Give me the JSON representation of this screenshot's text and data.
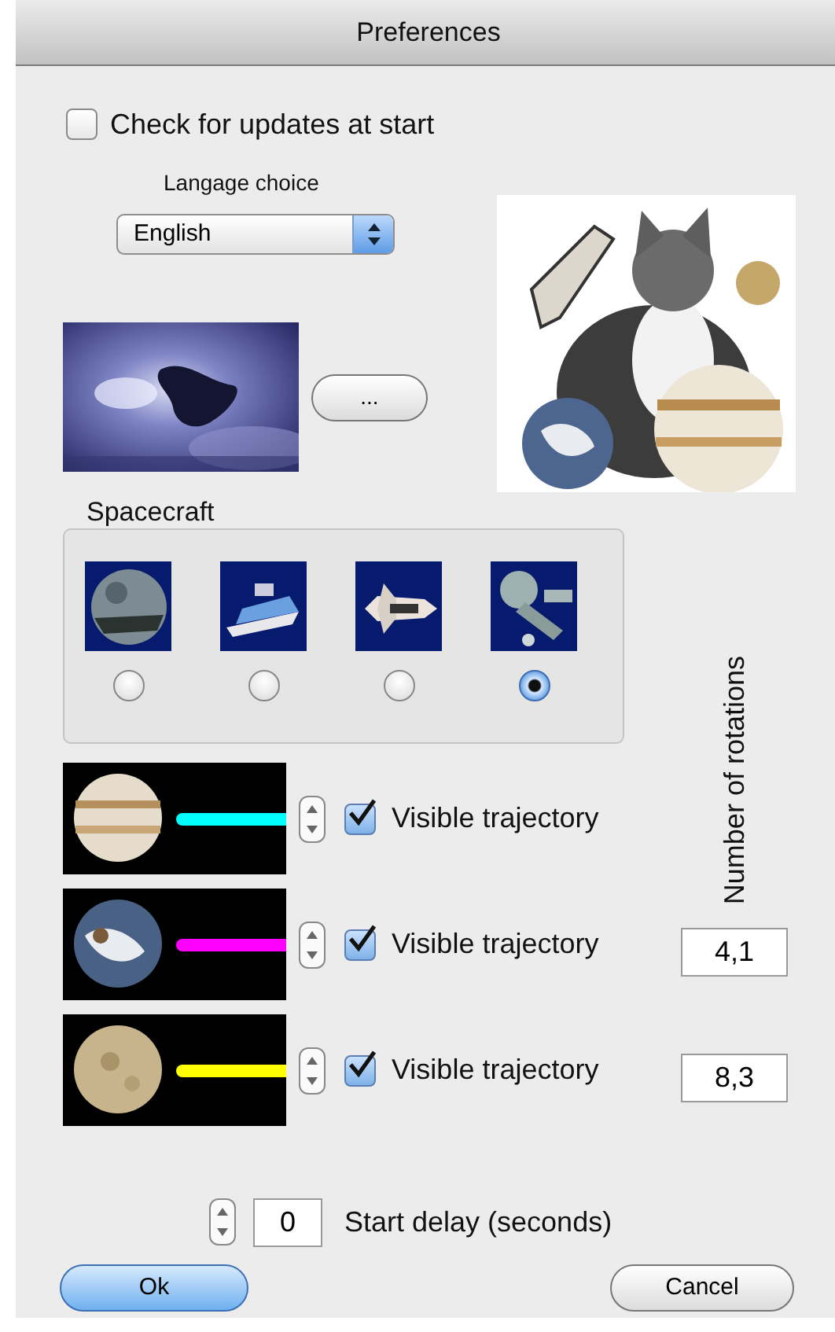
{
  "window": {
    "title": "Preferences"
  },
  "check_updates": {
    "label": "Check for updates at start",
    "checked": false
  },
  "language": {
    "label": "Langage choice",
    "value": "English"
  },
  "background": {
    "button_label": "..."
  },
  "spacecraft": {
    "title": "Spacecraft",
    "options": [
      {
        "kind": "sphere",
        "selected": false
      },
      {
        "kind": "wedge",
        "selected": false
      },
      {
        "kind": "shuttle",
        "selected": false
      },
      {
        "kind": "station",
        "selected": true
      }
    ]
  },
  "rotations_label": "Number of rotations",
  "planets": [
    {
      "kind": "banded",
      "color": "#00ffff",
      "visible_trajectory": true,
      "label": "Visible trajectory"
    },
    {
      "kind": "earth",
      "color": "#ff00ff",
      "visible_trajectory": true,
      "label": "Visible trajectory",
      "rotations": "4,1"
    },
    {
      "kind": "moon",
      "color": "#ffff00",
      "visible_trajectory": true,
      "label": "Visible trajectory",
      "rotations": "8,3"
    }
  ],
  "start_delay": {
    "value": "0",
    "label": "Start delay (seconds)"
  },
  "buttons": [
    {
      "label": "Ok",
      "default": true
    },
    {
      "label": "Cancel",
      "default": false
    }
  ]
}
